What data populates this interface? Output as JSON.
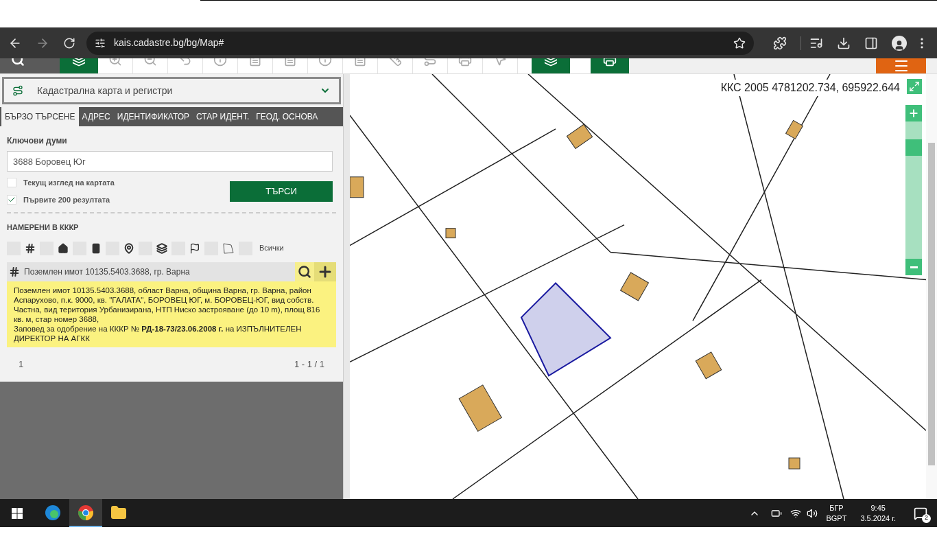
{
  "browser": {
    "url": "kais.cadastre.bg/bg/Map#"
  },
  "panel": {
    "title": "Кадастрална карта и регистри",
    "tabs": [
      {
        "label": "БЪРЗО ТЪРСЕНЕ",
        "selected": true
      },
      {
        "label": "АДРЕС",
        "selected": false
      },
      {
        "label": "ИДЕНТИФИКАТОР",
        "selected": false
      },
      {
        "label": "СТАР ИДЕНТ.",
        "selected": false
      },
      {
        "label": "ГЕОД. ОСНОВА",
        "selected": false
      }
    ],
    "keywords_label": "Ключови думи",
    "keywords_value": "3688 Боровец Юг",
    "options": [
      {
        "label": "Текущ изглед на картата",
        "checked": false
      },
      {
        "label": "Първите 200 резултата",
        "checked": true
      }
    ],
    "search_button": "ТЪРСИ",
    "results_heading": "НАМЕРЕНИ В КККР",
    "filters": [
      {
        "kind": "parcel",
        "checked": false
      },
      {
        "kind": "building",
        "checked": false
      },
      {
        "kind": "unit",
        "checked": false
      },
      {
        "kind": "address",
        "checked": false
      },
      {
        "kind": "layers",
        "checked": false
      },
      {
        "kind": "point",
        "checked": false
      },
      {
        "kind": "area",
        "checked": false
      },
      {
        "kind": "all",
        "label": "Всички",
        "checked": false
      }
    ],
    "result": {
      "title": "Поземлен имот 10135.5403.3688, гр. Варна",
      "details": "Поземлен имот 10135.5403.3688, област Варна, община Варна, гр. Варна, район Аспарухово, п.к. 9000, кв. \"ГАЛАТА\", БОРОВЕЦ ЮГ, м. БОРОВЕЦ-ЮГ, вид собств. Частна, вид територия Урбанизирана, НТП Ниско застрояване (до 10 m), площ 816 кв. м, стар номер 3688,",
      "order": "Заповед за одобрение на КККР № **РД-18-73/23.06.2008 г.** на ИЗПЪЛНИТЕЛЕН ДИРЕКТОР НА АГКК"
    },
    "page": "1",
    "range": "1 - 1 / 1"
  },
  "map": {
    "coordinates": "ККС 2005 4781202.734, 695922.644",
    "zoom": {
      "level": 0.85
    }
  },
  "taskbar": {
    "apps": [
      {
        "kind": "edge",
        "selected": false
      },
      {
        "kind": "chrome",
        "selected": true
      },
      {
        "kind": "explorer",
        "selected": false
      }
    ],
    "language": "БГР",
    "layout": "BGPT",
    "time": "9:45",
    "date": "3.5.2024 г.",
    "notifications": "2"
  }
}
